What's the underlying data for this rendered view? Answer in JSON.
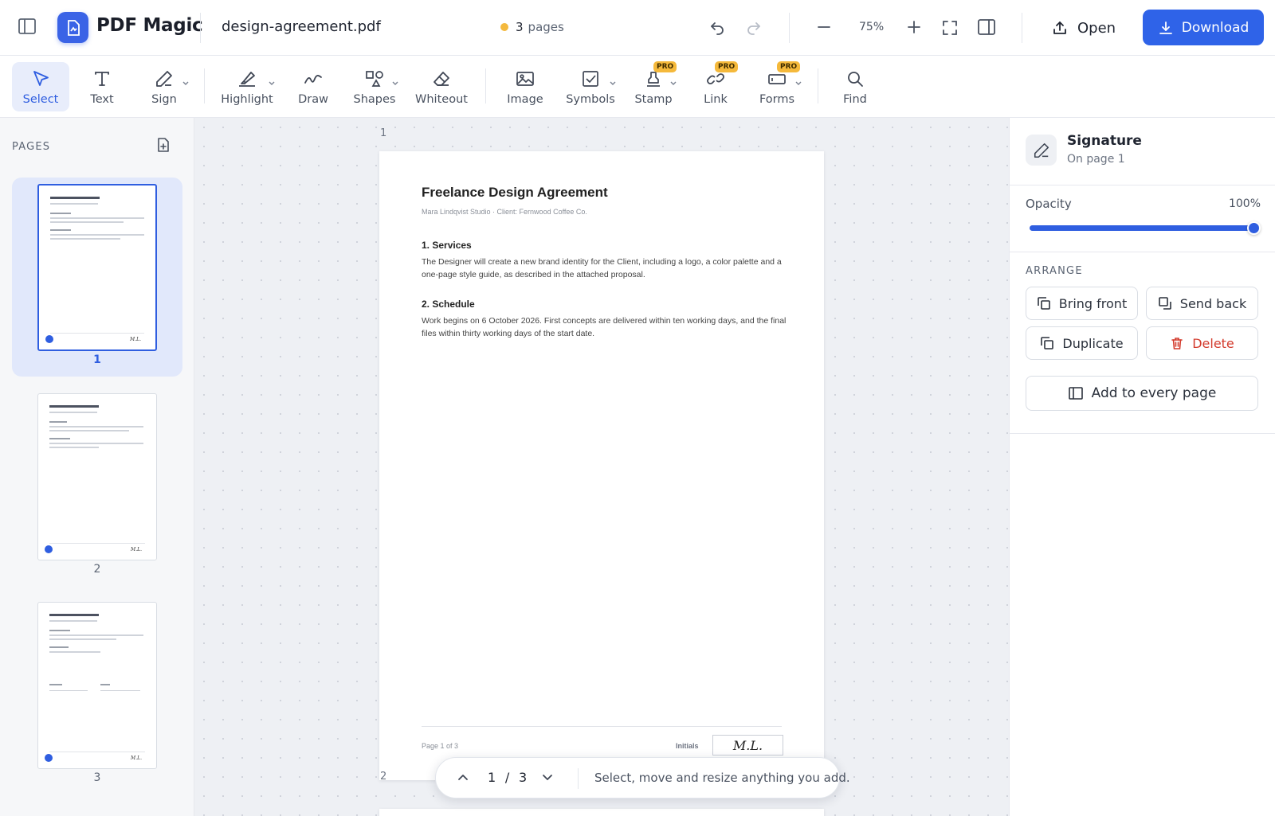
{
  "app": {
    "name": "PDF Magic",
    "file_name": "design-agreement.pdf",
    "page_count": "3",
    "page_count_label": "pages",
    "zoom": "75%"
  },
  "topbar": {
    "open_label": "Open",
    "download_label": "Download"
  },
  "tools": [
    {
      "label": "Select",
      "icon": "cursor-icon",
      "active": true
    },
    {
      "label": "Text",
      "icon": "text-icon"
    },
    {
      "label": "Sign",
      "icon": "pen-icon",
      "dropdown": true
    },
    {
      "label": "Highlight",
      "icon": "highlighter-icon",
      "dropdown": true
    },
    {
      "label": "Draw",
      "icon": "squiggle-icon"
    },
    {
      "label": "Shapes",
      "icon": "shapes-icon",
      "dropdown": true
    },
    {
      "label": "Whiteout",
      "icon": "eraser-icon"
    },
    {
      "label": "Image",
      "icon": "image-icon"
    },
    {
      "label": "Symbols",
      "icon": "checkbox-icon",
      "dropdown": true
    },
    {
      "label": "Stamp",
      "icon": "stamp-icon",
      "pro": true
    },
    {
      "label": "Link",
      "icon": "link-icon",
      "pro": true
    },
    {
      "label": "Forms",
      "icon": "form-icon",
      "pro": true,
      "dropdown": true
    },
    {
      "label": "Find",
      "icon": "search-icon"
    }
  ],
  "pro_badge": "PRO",
  "pages_panel": {
    "title": "PAGES",
    "thumbnails": [
      {
        "number": "1",
        "selected": true
      },
      {
        "number": "2"
      },
      {
        "number": "3"
      }
    ]
  },
  "canvas": {
    "page_markers": [
      "1",
      "2"
    ]
  },
  "document": {
    "title": "Freelance Design Agreement",
    "subtitle": "Mara Lindqvist Studio  ·  Client: Fernwood Coffee Co.",
    "sections": [
      {
        "heading": "1. Services",
        "body": "The Designer will create a new brand identity for the Client, including a logo, a color palette and a one-page style guide, as described in the attached proposal."
      },
      {
        "heading": "2. Schedule",
        "body": "Work begins on 6 October 2026. First concepts are delivered within ten working days, and the final files within thirty working days of the start date."
      }
    ],
    "footer_page": "Page 1 of 3",
    "footer_initials_label": "Initials",
    "initials": "M.L."
  },
  "page_nav": {
    "current": "1",
    "total": "3",
    "hint": "Select, move and resize anything you add."
  },
  "properties": {
    "title": "Signature",
    "subtitle": "On page 1",
    "opacity_label": "Opacity",
    "opacity_value": "100%",
    "opacity_fraction": 1.0,
    "arrange_label": "ARRANGE",
    "bring_front": "Bring front",
    "send_back": "Send back",
    "duplicate": "Duplicate",
    "delete": "Delete",
    "add_every_page": "Add to every page"
  },
  "colors": {
    "accent": "#2f5ee0",
    "pro": "#f5b93b",
    "danger": "#d33b2d",
    "status_dot": "#f4b93e"
  }
}
